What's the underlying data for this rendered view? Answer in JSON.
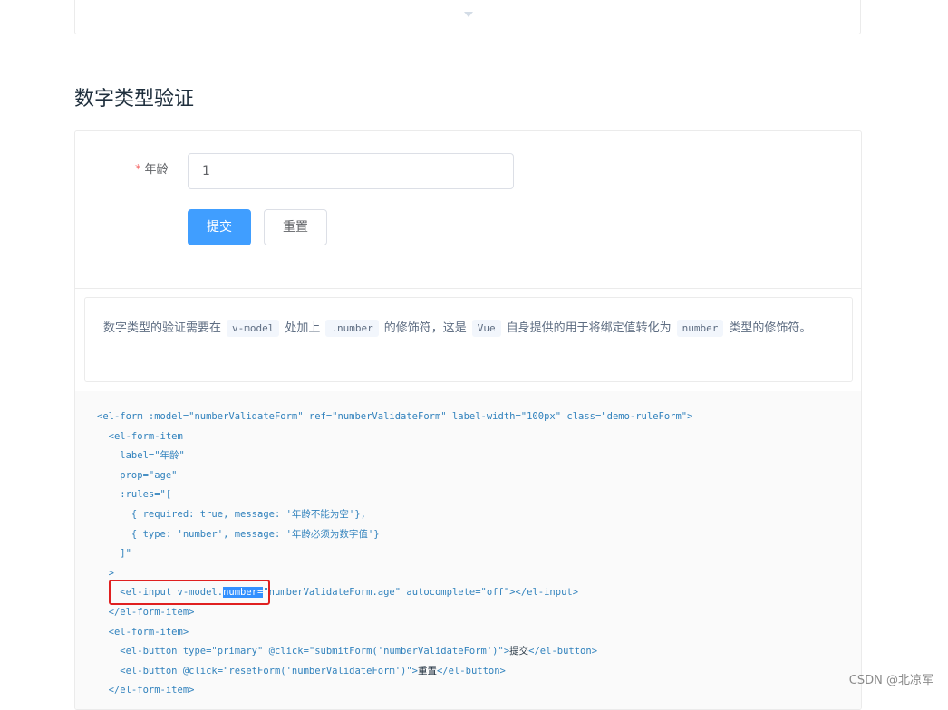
{
  "section": {
    "title": "数字类型验证"
  },
  "form": {
    "required_mark": "*",
    "label": "年龄",
    "input_value": "1",
    "submit_label": "提交",
    "reset_label": "重置"
  },
  "description": {
    "t1": "数字类型的验证需要在",
    "c1": "v-model",
    "t2": "处加上",
    "c2": ".number",
    "t3": "的修饰符，这是",
    "c3": "Vue",
    "t4": "自身提供的用于将绑定值转化为",
    "c4": "number",
    "t5": "类型的修饰符。"
  },
  "code_lines": {
    "l1": "<el-form :model=\"numberValidateForm\" ref=\"numberValidateForm\" label-width=\"100px\" class=\"demo-ruleForm\">",
    "l2": "  <el-form-item",
    "l3": "    label=\"年龄\"",
    "l4": "    prop=\"age\"",
    "l5": "    :rules=\"[",
    "l6": "      { required: true, message: '年龄不能为空'},",
    "l7": "      { type: 'number', message: '年龄必须为数字值'}",
    "l8": "    ]\"",
    "l9": "  >",
    "l10a": "    <el-input v-model.",
    "l10sel": "number=",
    "l10b": "\"numberValidateForm.age\" autocomplete=\"off\"></el-input>",
    "l11": "  </el-form-item>",
    "l12": "  <el-form-item>",
    "l13a": "    <el-button type=\"primary\" @click=\"submitForm('numberValidateForm')\">",
    "l13b": "提交",
    "l13c": "</el-button>",
    "l14a": "    <el-button @click=\"resetForm('numberValidateForm')\">",
    "l14b": "重置",
    "l14c": "</el-button>",
    "l15": "  </el-form-item>"
  },
  "watermark": "CSDN @北凉军",
  "colors": {
    "primary": "#409eff",
    "required": "#f56c6c",
    "highlight_box": "#e02020",
    "selection": "#3390ff"
  },
  "icons": {
    "expand": "caret-down-icon"
  }
}
